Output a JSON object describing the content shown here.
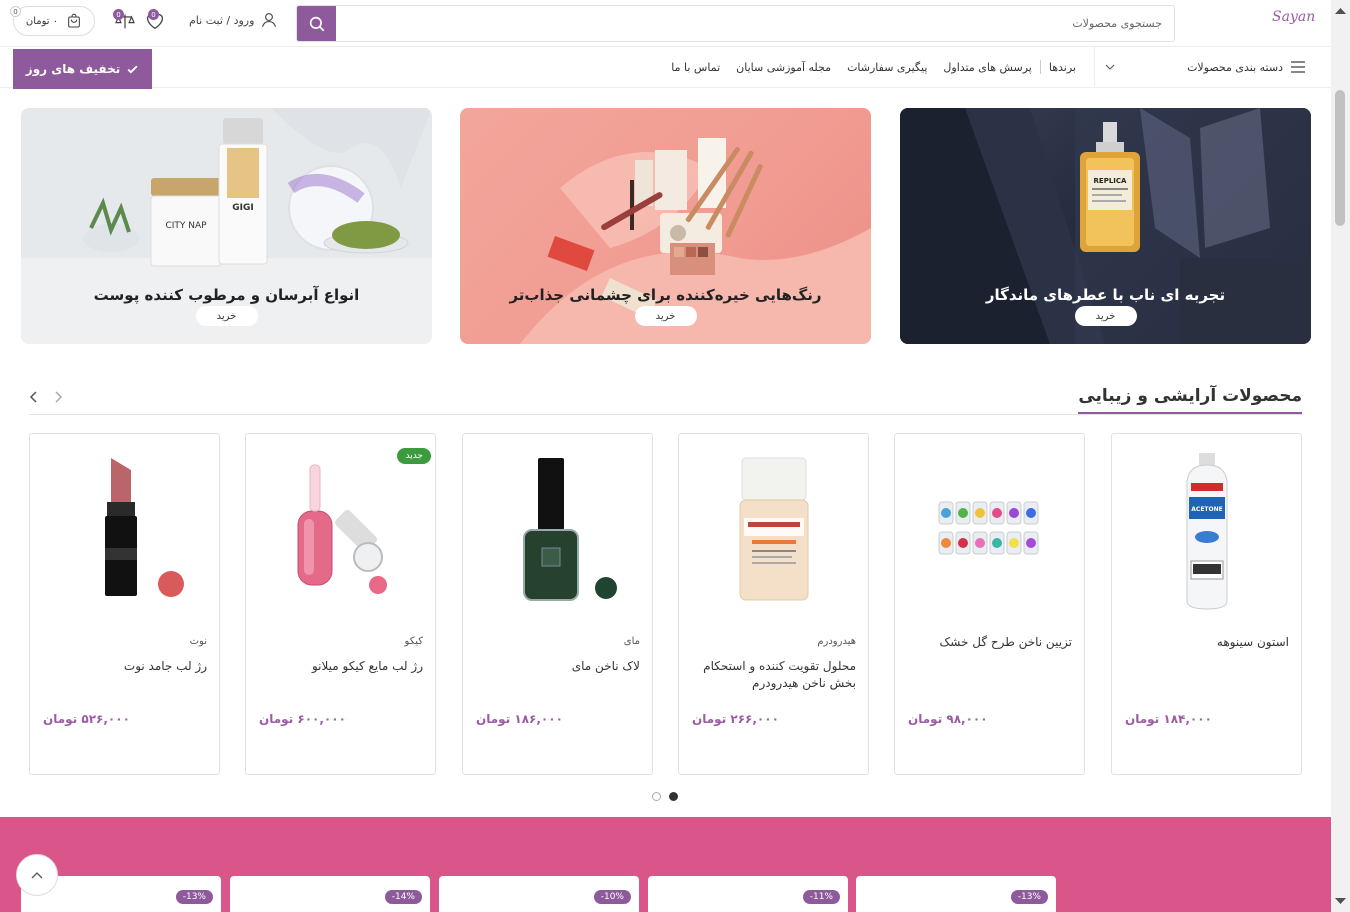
{
  "header": {
    "logo_text": "Sayan",
    "search_placeholder": "جستجوی محصولات",
    "account_label": "ورود / ثبت نام",
    "compare_count": "0",
    "wishlist_count": "0",
    "cart_total": "۰ تومان",
    "cart_count": "0"
  },
  "nav": {
    "categories_label": "دسته بندی محصولات",
    "links": [
      "برندها",
      "پرسش های متداول",
      "پیگیری سفارشات",
      "مجله آموزشی سایان",
      "تماس با ما"
    ],
    "deals_button": "تخفیف های روز"
  },
  "banners": [
    {
      "title": "تجربه ای ناب با عطرهای ماندگار",
      "button": "خرید",
      "bottle_label": "REPLICA"
    },
    {
      "title": "رنگ‌هایی خیره‌کننده برای چشمانی جذاب‌تر",
      "button": "خرید"
    },
    {
      "title": "انواع آبرسان و مرطوب کننده پوست",
      "button": "خرید",
      "jar_label": "CITY NAP",
      "brand_label": "GIGI"
    }
  ],
  "section": {
    "title": "محصولات آرایشی و زیبایی"
  },
  "products": [
    {
      "brand": "",
      "name": "استون سینوهه",
      "price": "۱۸۴,۰۰۰ تومان",
      "is_new": false,
      "img_label": "ACETONE"
    },
    {
      "brand": "",
      "name": "تزیین ناخن طرح گل خشک",
      "price": "۹۸,۰۰۰ تومان",
      "is_new": false
    },
    {
      "brand": "هیدرودرم",
      "name": "محلول تقویت کننده و استحکام بخش ناخن هیدرودرم",
      "price": "۲۶۶,۰۰۰ تومان",
      "is_new": false
    },
    {
      "brand": "مای",
      "name": "لاک ناخن مای",
      "price": "۱۸۶,۰۰۰ تومان",
      "is_new": false
    },
    {
      "brand": "کیکو",
      "name": "رژ لب مایع کیکو میلانو",
      "price": "۶۰۰,۰۰۰ تومان",
      "is_new": true,
      "badge": "جدید"
    },
    {
      "brand": "نوت",
      "name": "رژ لب جامد نوت",
      "price": "۵۲۶,۰۰۰ تومان",
      "is_new": false
    }
  ],
  "deals": [
    {
      "discount": "-13%"
    },
    {
      "discount": "-11%"
    },
    {
      "discount": "-10%"
    },
    {
      "discount": "-14%"
    },
    {
      "discount": "-13%"
    }
  ],
  "colors": {
    "accent": "#8f5a9c",
    "price": "#9b5ba3",
    "strip": "#d9558a",
    "new_badge": "#3d9b3f"
  },
  "icons": [
    "search-icon",
    "user-icon",
    "compare-icon",
    "heart-icon",
    "bag-icon",
    "menu-icon",
    "chevron-down-icon",
    "check-icon",
    "chevron-left-icon",
    "chevron-right-icon",
    "arrow-up-icon"
  ]
}
